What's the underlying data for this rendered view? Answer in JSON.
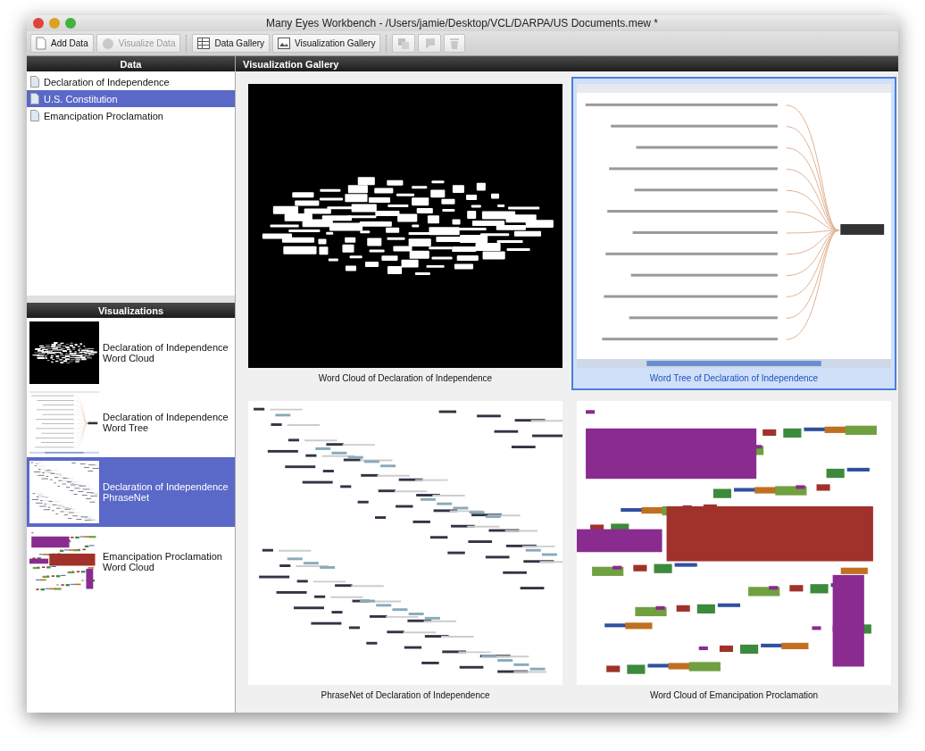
{
  "window": {
    "title": "Many Eyes Workbench - /Users/jamie/Desktop/VCL/DARPA/US Documents.mew *"
  },
  "toolbar": [
    {
      "kind": "add",
      "label": "Add Data",
      "disabled": false
    },
    {
      "kind": "visualize",
      "label": "Visualize Data",
      "disabled": true
    },
    {
      "kind": "separator"
    },
    {
      "kind": "table",
      "label": "Data Gallery",
      "disabled": false
    },
    {
      "kind": "chart",
      "label": "Visualization Gallery",
      "disabled": false
    },
    {
      "kind": "separator"
    },
    {
      "kind": "copy",
      "disabled": true
    },
    {
      "kind": "comment",
      "disabled": true
    },
    {
      "kind": "trash",
      "disabled": true
    }
  ],
  "data_panel": {
    "title": "Data",
    "items": [
      {
        "label": "Declaration of Independence",
        "selected": false
      },
      {
        "label": "U.S. Constitution",
        "selected": true
      },
      {
        "label": "Emancipation Proclamation",
        "selected": false
      }
    ]
  },
  "visualizations_panel": {
    "title": "Visualizations",
    "items": [
      {
        "kind": "word_cloud_dark",
        "name": "Declaration of Independence",
        "type": "Word Cloud",
        "selected": false
      },
      {
        "kind": "word_tree",
        "name": "Declaration of Independence",
        "type": "Word Tree",
        "selected": false
      },
      {
        "kind": "phrase_net",
        "name": "Declaration of Independence",
        "type": "PhraseNet",
        "selected": true
      },
      {
        "kind": "word_cloud_color",
        "name": "Emancipation Proclamation",
        "type": "Word Cloud",
        "selected": false
      }
    ]
  },
  "gallery": {
    "title": "Visualization Gallery",
    "items": [
      {
        "kind": "word_cloud_dark",
        "caption": "Word Cloud of Declaration of Independence",
        "selected": false
      },
      {
        "kind": "word_tree",
        "caption": "Word Tree of Declaration of Independence",
        "selected": true
      },
      {
        "kind": "phrase_net",
        "caption": "PhraseNet of Declaration of Independence",
        "selected": false
      },
      {
        "kind": "word_cloud_color",
        "caption": "Word Cloud of Emancipation Proclamation",
        "selected": false
      }
    ]
  }
}
